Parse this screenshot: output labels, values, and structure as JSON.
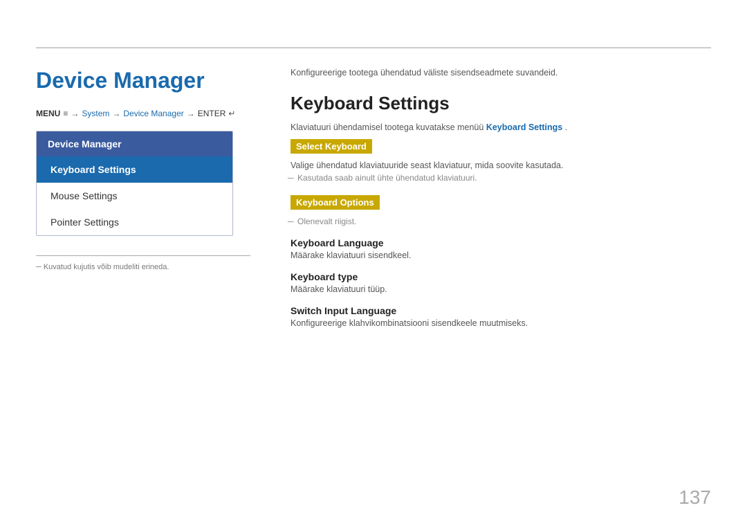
{
  "page": {
    "title": "Device Manager",
    "page_number": "137",
    "top_intro": "Konfigureerige tootega ühendatud väliste sisendseadmete suvandeid.",
    "left_footnote": "─  Kuvatud kujutis võib mudeliti erineda."
  },
  "breadcrumb": {
    "menu": "MENU",
    "menu_icon": "≡",
    "arrow1": "→",
    "system": "System",
    "arrow2": "→",
    "device_manager": "Device Manager",
    "arrow3": "→",
    "enter": "ENTER",
    "enter_icon": "↵"
  },
  "sidebar": {
    "header": "Device Manager",
    "items": [
      {
        "label": "Keyboard Settings",
        "active": true
      },
      {
        "label": "Mouse Settings",
        "active": false
      },
      {
        "label": "Pointer Settings",
        "active": false
      }
    ]
  },
  "main": {
    "section_title": "Keyboard Settings",
    "section_intro": "Klaviatuuri ühendamisel tootega kuvatakse menüü",
    "section_intro_highlight": "Keyboard Settings",
    "section_intro_end": ".",
    "select_keyboard_label": "Select Keyboard",
    "select_keyboard_desc": "Valige ühendatud klaviatuuride seast klaviatuur, mida soovite kasutada.",
    "select_keyboard_note": "Kasutada saab ainult ühte ühendatud klaviatuuri.",
    "keyboard_options_label": "Keyboard Options",
    "keyboard_options_note": "Olenevalt riigist.",
    "options": [
      {
        "title": "Keyboard Language",
        "desc": "Määrake klaviatuuri sisendkeel."
      },
      {
        "title": "Keyboard type",
        "desc": "Määrake klaviatuuri tüüp."
      },
      {
        "title": "Switch Input Language",
        "desc": "Konfigureerige klahvikombinatsiooni sisendkeele muutmiseks."
      }
    ]
  }
}
